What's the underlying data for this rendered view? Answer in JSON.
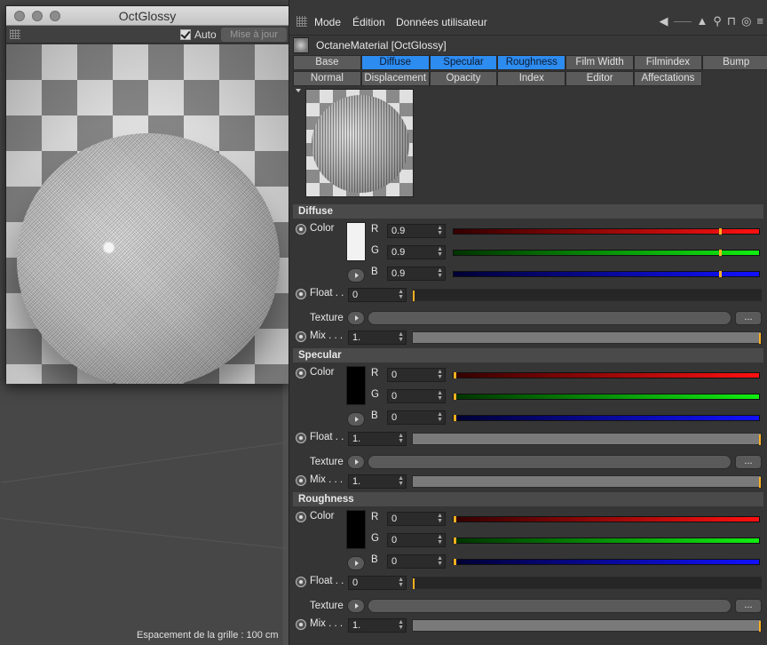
{
  "viewport": {
    "grid_label": "Espacement de la grille : 100 cm"
  },
  "render_window": {
    "title": "OctGlossy",
    "auto_label": "Auto",
    "update_label": "Mise à jour"
  },
  "menubar": {
    "items": [
      "Mode",
      "Édition",
      "Données utilisateur"
    ]
  },
  "material": {
    "name": "OctaneMaterial [OctGlossy]"
  },
  "tabs": {
    "row1": [
      {
        "label": "Base",
        "active": false
      },
      {
        "label": "Diffuse",
        "active": true
      },
      {
        "label": "Specular",
        "active": true
      },
      {
        "label": "Roughness",
        "active": true
      },
      {
        "label": "Film Width",
        "active": false
      },
      {
        "label": "Filmindex",
        "active": false
      },
      {
        "label": "Bump",
        "active": false
      }
    ],
    "row2": [
      {
        "label": "Normal",
        "active": false
      },
      {
        "label": "Displacement",
        "active": false
      },
      {
        "label": "Opacity",
        "active": false
      },
      {
        "label": "Index",
        "active": false
      },
      {
        "label": "Editor",
        "active": false
      },
      {
        "label": "Affectations",
        "active": false
      }
    ]
  },
  "sections": [
    {
      "title": "Diffuse",
      "color_label": "Color",
      "swatch": "#f2f2f2",
      "r": "0.9",
      "g": "0.9",
      "b": "0.9",
      "r_level": 0.9,
      "g_level": 0.9,
      "b_level": 0.9,
      "float_label": "Float . .",
      "float": "0",
      "float_level": 0.0,
      "float_dark": true,
      "texture_label": "Texture",
      "texture_btn": "...",
      "mix_label": "Mix . . .",
      "mix": "1.",
      "mix_level": 1.0
    },
    {
      "title": "Specular",
      "color_label": "Color",
      "swatch": "#000000",
      "r": "0",
      "g": "0",
      "b": "0",
      "r_level": 0,
      "g_level": 0,
      "b_level": 0,
      "float_label": "Float . .",
      "float": "1.",
      "float_level": 1.0,
      "float_dark": false,
      "texture_label": "Texture",
      "texture_btn": "...",
      "mix_label": "Mix . . .",
      "mix": "1.",
      "mix_level": 1.0
    },
    {
      "title": "Roughness",
      "color_label": "Color",
      "swatch": "#000000",
      "r": "0",
      "g": "0",
      "b": "0",
      "r_level": 0,
      "g_level": 0,
      "b_level": 0,
      "float_label": "Float . .",
      "float": "0",
      "float_level": 0.0,
      "float_dark": true,
      "texture_label": "Texture",
      "texture_btn": "...",
      "mix_label": "Mix . . .",
      "mix": "1.",
      "mix_level": 1.0
    }
  ],
  "channel_labels": {
    "r": "R",
    "g": "G",
    "b": "B"
  },
  "colors": {
    "accent": "#2d8cf0",
    "knob": "#ffb020",
    "red": "#d01010",
    "green": "#10d010",
    "blue": "#1010d8"
  },
  "icons": [
    "arrow-left-icon",
    "arrow-up-icon",
    "search-icon",
    "lock-icon",
    "target-icon",
    "settings-icon"
  ]
}
